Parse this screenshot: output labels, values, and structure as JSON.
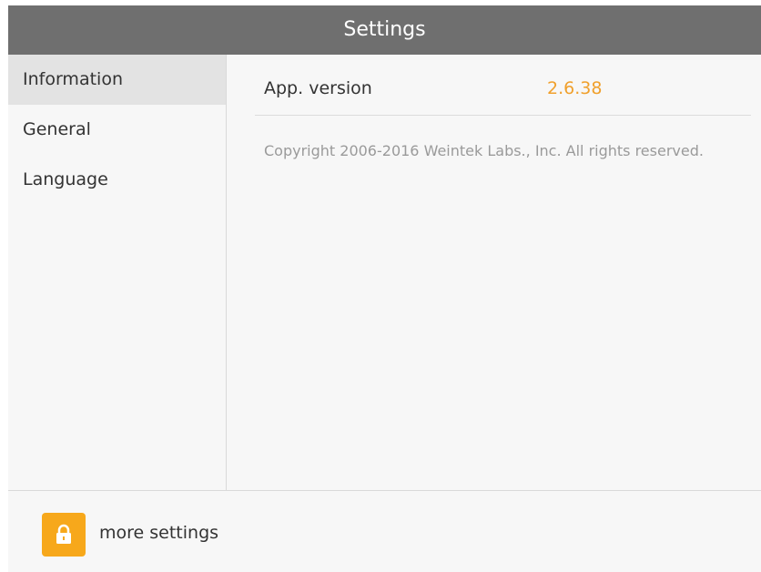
{
  "window": {
    "title": "Settings"
  },
  "sidebar": {
    "items": [
      {
        "label": "Information",
        "selected": true
      },
      {
        "label": "General",
        "selected": false
      },
      {
        "label": "Language",
        "selected": false
      }
    ]
  },
  "information": {
    "version_label": "App. version",
    "version_value": "2.6.38",
    "copyright": "Copyright 2006-2016 Weintek Labs., Inc. All rights reserved."
  },
  "footer": {
    "lock_icon": "lock-icon",
    "more_settings_label": "more settings"
  },
  "colors": {
    "titlebar": "#6f6f6f",
    "accent": "#f7a81b",
    "version_value": "#f0a02c"
  }
}
